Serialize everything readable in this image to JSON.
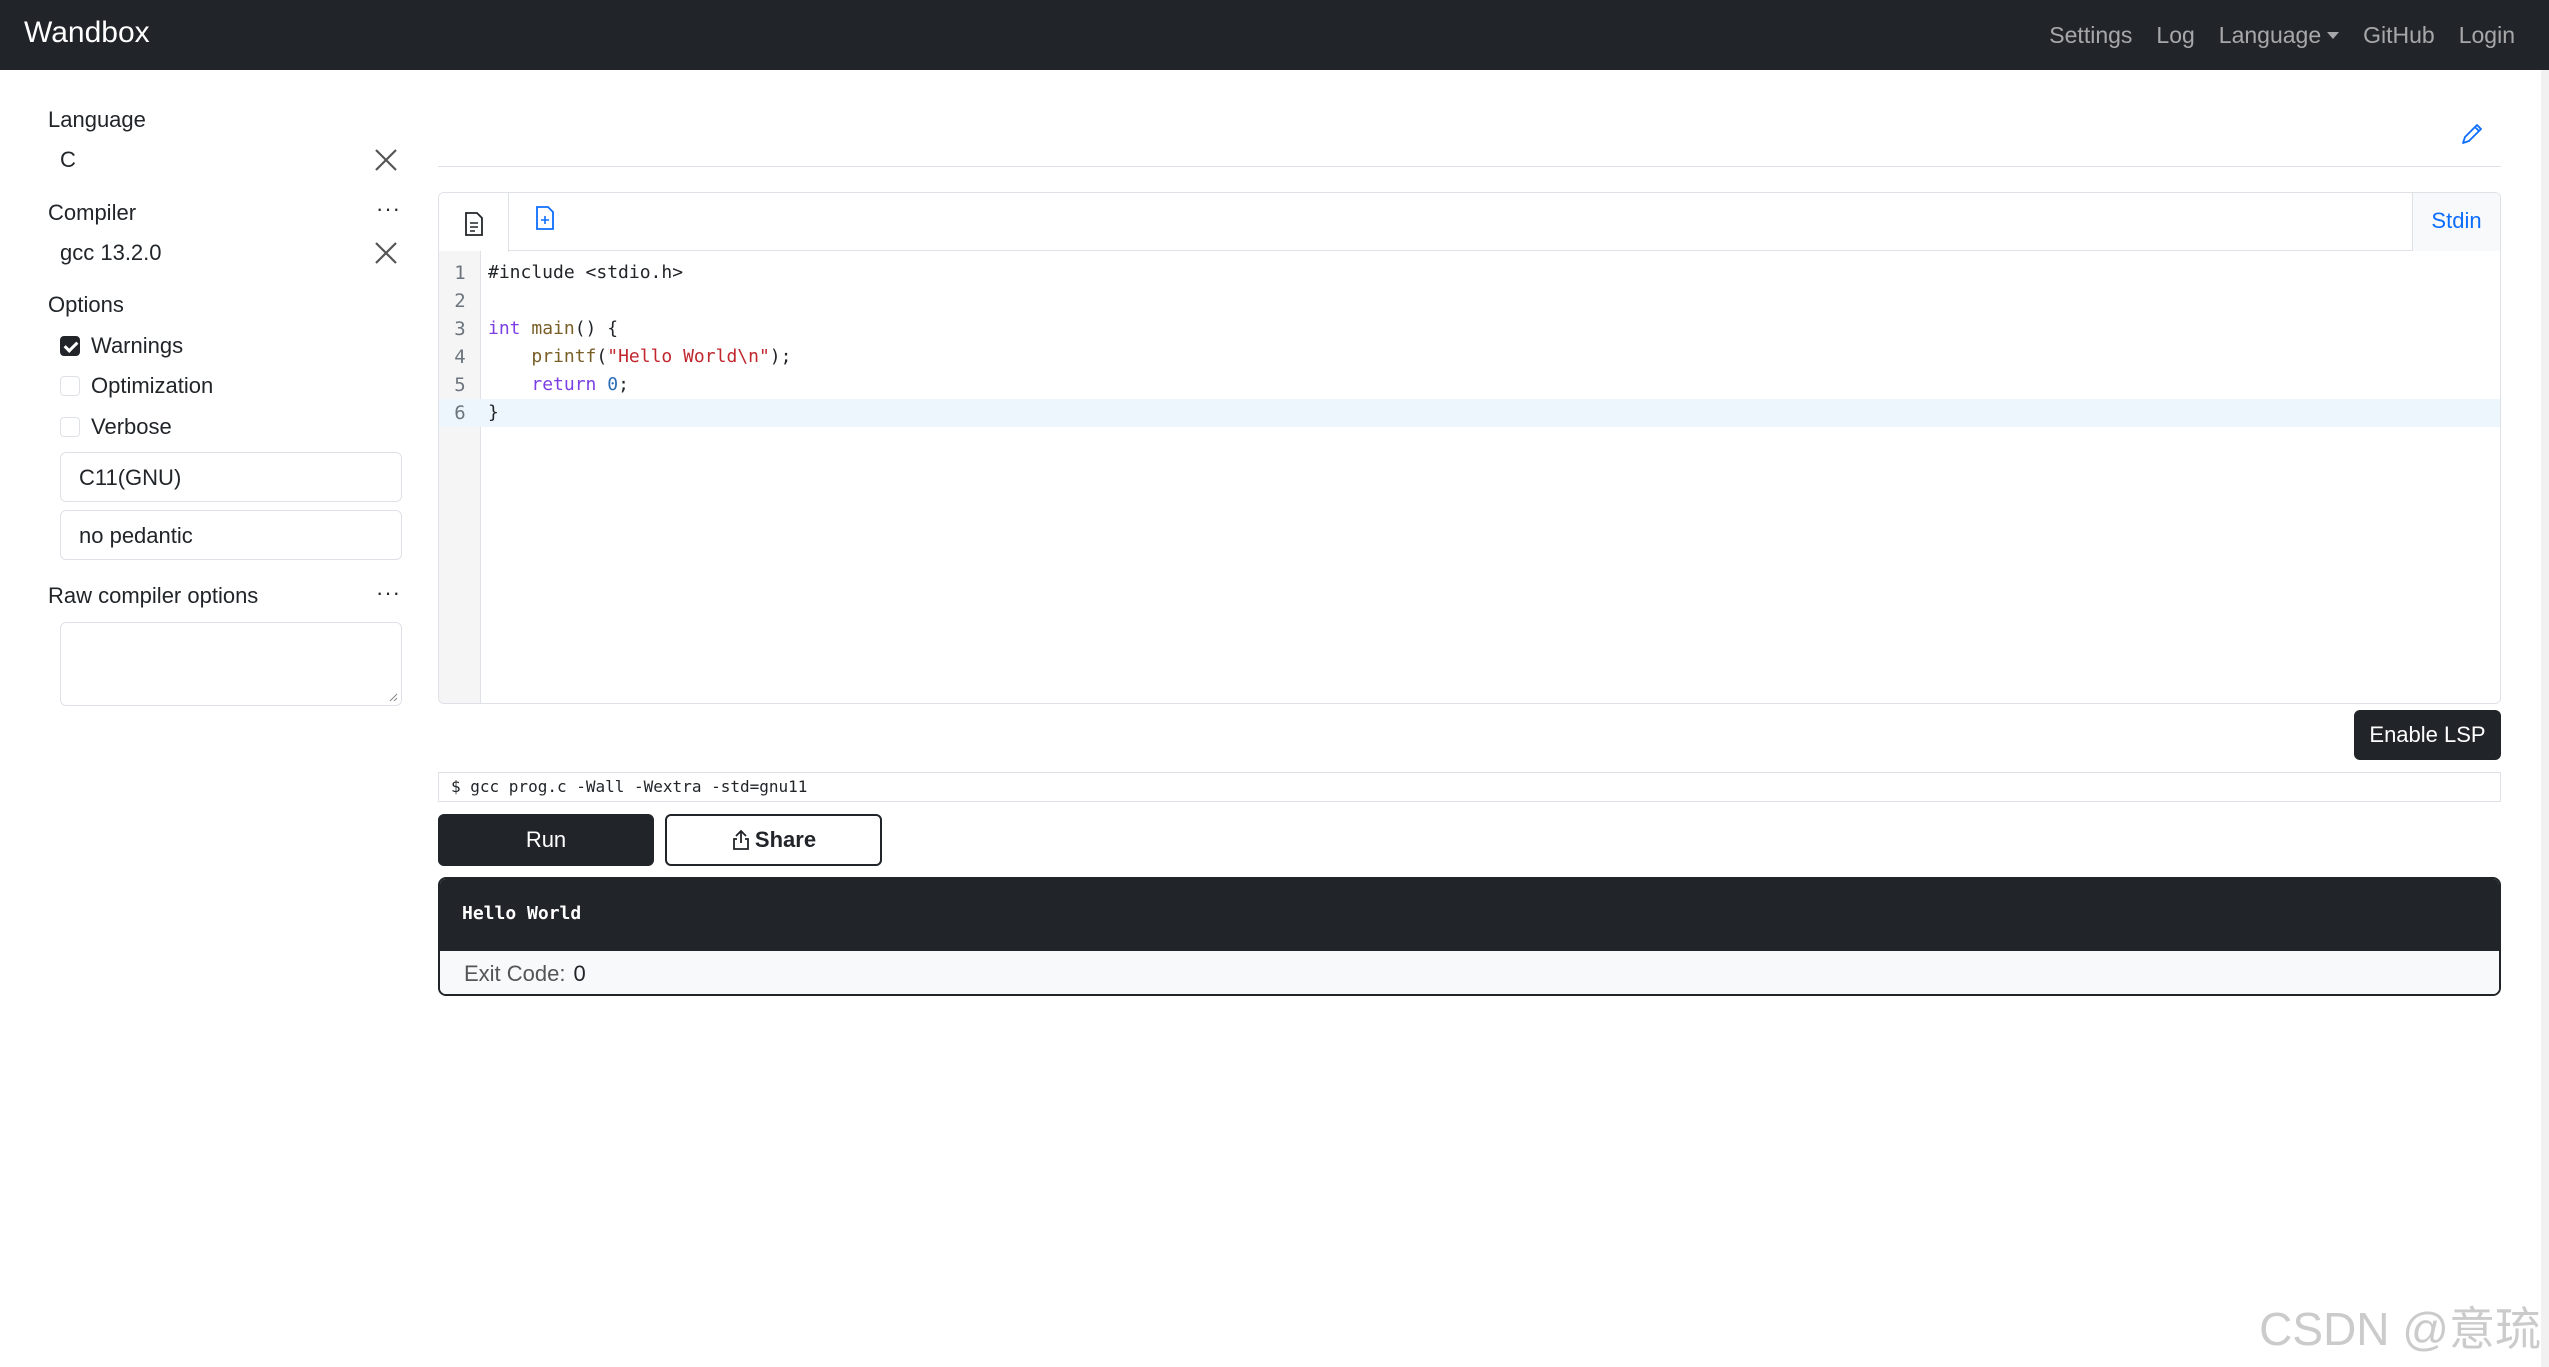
{
  "navbar": {
    "brand": "Wandbox",
    "links": {
      "settings": "Settings",
      "log": "Log",
      "language": "Language",
      "github": "GitHub",
      "login": "Login"
    }
  },
  "sidebar": {
    "language_label": "Language",
    "language_value": "C",
    "compiler_label": "Compiler",
    "compiler_value": "gcc 13.2.0",
    "more_label": "···",
    "options_label": "Options",
    "options": [
      {
        "label": "Warnings",
        "checked": true
      },
      {
        "label": "Optimization",
        "checked": false
      },
      {
        "label": "Verbose",
        "checked": false
      }
    ],
    "std_select": "C11(GNU)",
    "pedantic_select": "no pedantic",
    "raw_options_label": "Raw compiler options"
  },
  "editor": {
    "stdin_tab": "Stdin",
    "line_numbers": [
      "1",
      "2",
      "3",
      "4",
      "5",
      "6"
    ],
    "lines": [
      "#include <stdio.h>",
      "",
      "int main() {",
      "    printf(\"Hello World\\n\");",
      "    return 0;",
      "}"
    ]
  },
  "actions": {
    "enable_lsp": "Enable LSP",
    "command_line": "$ gcc prog.c -Wall -Wextra -std=gnu11",
    "run": "Run",
    "share": "Share"
  },
  "output": {
    "stdout": "Hello World",
    "exit_label": "Exit Code:",
    "exit_code": "0"
  },
  "watermark": "CSDN @意琉",
  "colors": {
    "navbar": "#212529",
    "accent": "#0d6efd",
    "keyword": "#7b3fe4",
    "string": "#c0262d"
  }
}
